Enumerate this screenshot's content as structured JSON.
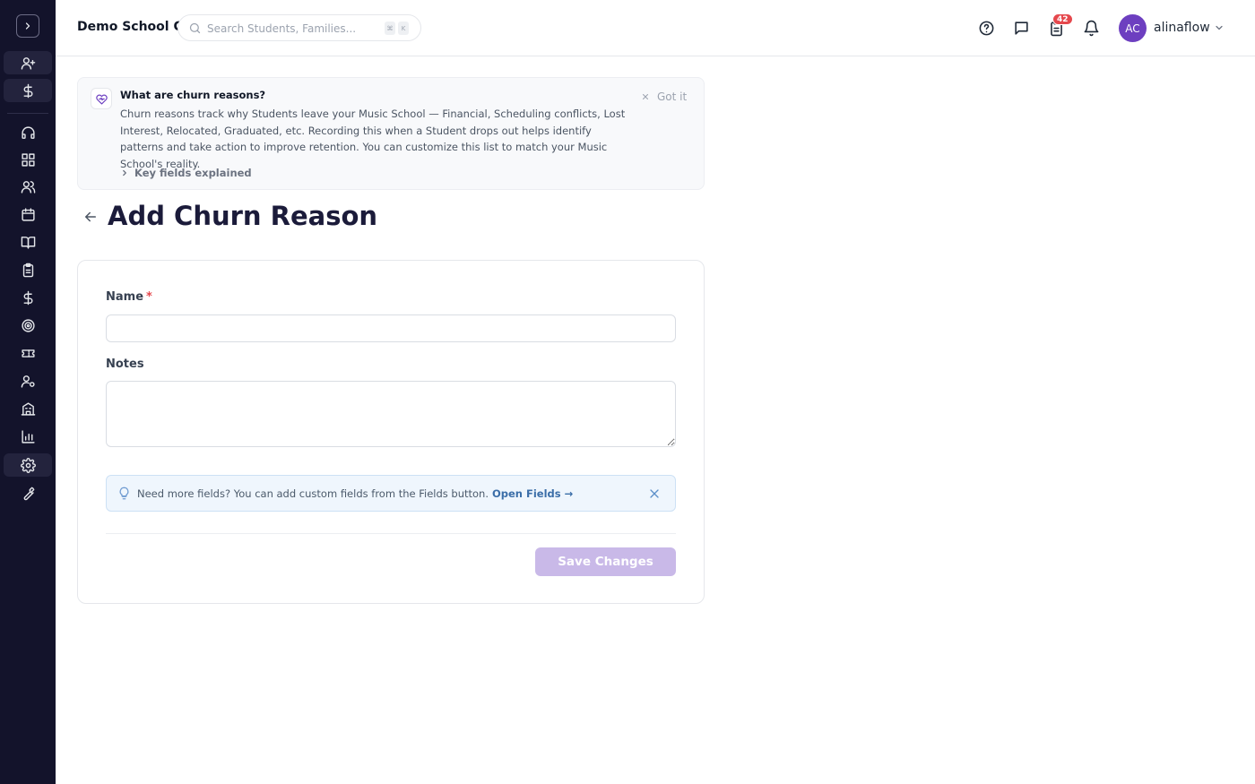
{
  "header": {
    "school_name": "Demo School C",
    "search_placeholder": "Search Students, Families...",
    "search_shortcut": [
      "⌘",
      "K"
    ],
    "tasks_badge": "42",
    "avatar_initials": "AC",
    "username": "alinaflow"
  },
  "sidebar": {
    "items": [
      {
        "name": "add-user-icon"
      },
      {
        "name": "dollar-icon"
      },
      {
        "name": "headset-icon"
      },
      {
        "name": "dashboard-icon"
      },
      {
        "name": "users-icon"
      },
      {
        "name": "calendar-icon"
      },
      {
        "name": "book-icon"
      },
      {
        "name": "clipboard-icon"
      },
      {
        "name": "billing-dollar-icon"
      },
      {
        "name": "target-icon"
      },
      {
        "name": "ticket-icon"
      },
      {
        "name": "user-settings-icon"
      },
      {
        "name": "building-icon"
      },
      {
        "name": "chart-icon"
      },
      {
        "name": "settings-icon"
      },
      {
        "name": "wrench-icon"
      }
    ]
  },
  "info_banner": {
    "title": "What are churn reasons?",
    "body": "Churn reasons track why Students leave your Music School — Financial, Scheduling conflicts, Lost Interest, Relocated, Graduated, etc. Recording this when a Student drops out helps identify patterns and take action to improve retention. You can customize this list to match your Music School's reality.",
    "dismiss_label": "Got it",
    "key_fields_label": "Key fields explained"
  },
  "page": {
    "title": "Add Churn Reason"
  },
  "form": {
    "name_label": "Name",
    "required_mark": "*",
    "name_value": "",
    "notes_label": "Notes",
    "notes_value": "",
    "tip_text": "Need more fields? You can add custom fields from the Fields button.",
    "tip_link": "Open Fields →",
    "save_label": "Save Changes"
  },
  "colors": {
    "sidebar_bg": "#13132b",
    "accent_purple": "#6d3fc0",
    "save_button_disabled": "#c9b9e8",
    "badge_red": "#e5484d",
    "tip_bg": "#eff6fd",
    "tip_link": "#3b6ea8"
  }
}
